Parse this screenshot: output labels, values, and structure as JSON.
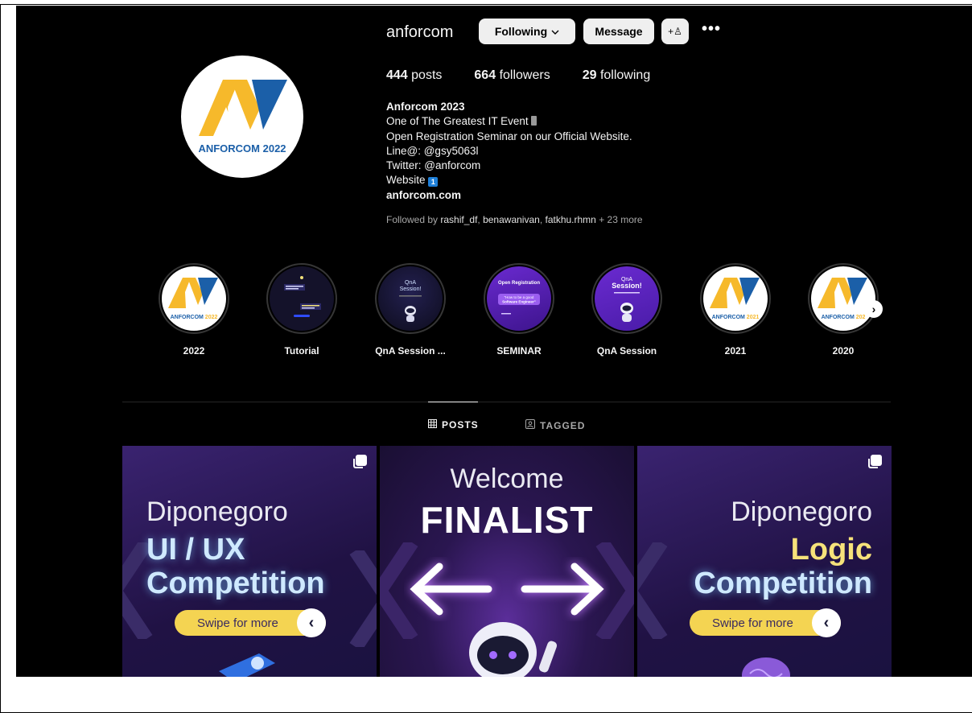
{
  "profile": {
    "username": "anforcom",
    "following_btn": "Following",
    "message_btn": "Message",
    "add_user_glyph": "+♙",
    "more_glyph": "•••",
    "logo_text": "ANFORCOM 2022"
  },
  "stats": [
    {
      "count": "444",
      "label": "posts"
    },
    {
      "count": "664",
      "label": "followers"
    },
    {
      "count": "29",
      "label": "following"
    }
  ],
  "bio": {
    "name": "Anforcom 2023",
    "line1": "One of The Greatest IT Event",
    "line2": "Open Registration Seminar on our Official Website.",
    "line3": "Line@: @gsy5063l",
    "line4": "Twitter: @anforcom",
    "line5": "Website",
    "website_badge": "1",
    "link": "anforcom.com"
  },
  "followed_by": {
    "prefix": "Followed by ",
    "user1": "rashif_df",
    "sep1": ", ",
    "user2": "benawanivan",
    "sep2": ", ",
    "user3": "fatkhu.rhmn",
    "suffix": " + 23 more"
  },
  "highlights": [
    {
      "label": "2022",
      "year_text": "2022"
    },
    {
      "label": "Tutorial"
    },
    {
      "label": "QnA Session ...",
      "cover_text": "QnA Session!"
    },
    {
      "label": "SEMINAR",
      "cover_text": "Open Registration"
    },
    {
      "label": "QnA Session",
      "cover_text": "QnA Session!"
    },
    {
      "label": "2021",
      "year_text": "2021"
    },
    {
      "label": "2020",
      "year_text": "202"
    }
  ],
  "highlights_next": "›",
  "tabs": {
    "posts": "POSTS",
    "tagged": "TAGGED"
  },
  "posts": [
    {
      "line1": "Diponegoro",
      "line2": "UI / UX",
      "line3": "Competition",
      "swipe": "Swipe for more",
      "arrow": "‹"
    },
    {
      "line1": "Welcome",
      "line2": "FINALIST"
    },
    {
      "line1": "Diponegoro",
      "line2": "Logic",
      "line3": "Competition",
      "swipe": "Swipe for more",
      "arrow": "‹"
    }
  ],
  "colors": {
    "background": "#000000",
    "button": "#efefef",
    "post_purple": "#2a1650",
    "swipe_yellow": "#f4d452",
    "logo_blue": "#1b5fa8",
    "logo_yellow": "#f6b92b"
  }
}
